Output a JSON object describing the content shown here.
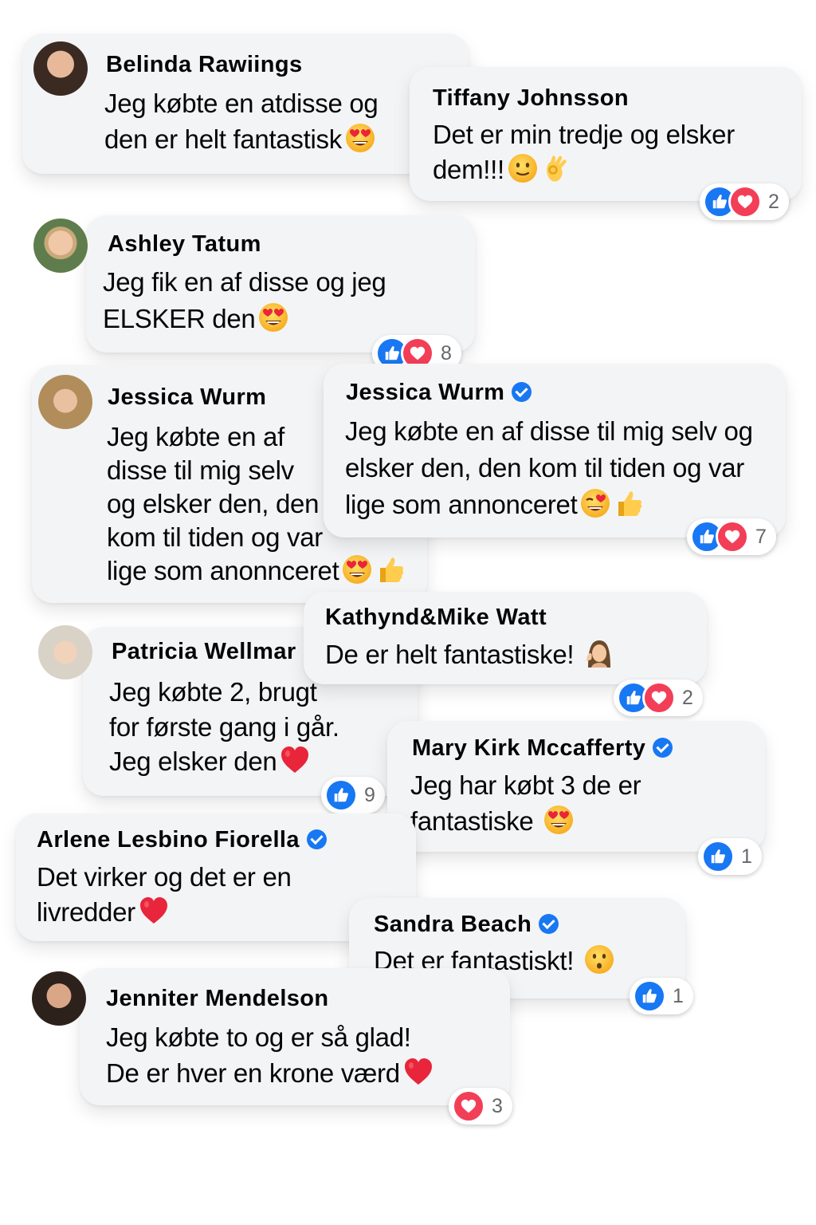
{
  "colors": {
    "bubble_bg": "#f3f4f6",
    "like_blue": "#1877f2",
    "love_red": "#f33e58",
    "verified_blue": "#1877f2",
    "count_gray": "#65676b"
  },
  "comments": [
    {
      "name": "Belinda Rawiings",
      "lines": [
        "Jeg købte en atdisse og",
        "den er helt fantastisk"
      ],
      "emojis": [
        "heart-eyes"
      ]
    },
    {
      "name": "Tiffany Johnsson",
      "lines": [
        "Det er min tredje og elsker",
        "dem!!!"
      ],
      "emojis": [
        "smiling-face",
        "ok-hand"
      ],
      "reactions": {
        "types": [
          "like",
          "love"
        ],
        "count": "2"
      }
    },
    {
      "name": "Ashley Tatum",
      "lines": [
        "Jeg fik en af disse og jeg",
        "ELSKER den"
      ],
      "emojis": [
        "heart-eyes"
      ],
      "reactions": {
        "types": [
          "like",
          "love"
        ],
        "count": "8"
      }
    },
    {
      "name": "Jessica Wurm",
      "lines": [
        "Jeg købte en af",
        "disse til mig selv",
        "og elsker den, den",
        "kom til tiden og var",
        "lige som anonnceret"
      ],
      "emojis": [
        "heart-eyes",
        "thumbs-up"
      ]
    },
    {
      "name": "Jessica Wurm",
      "verified": true,
      "lines": [
        "Jeg købte en af disse til mig selv og",
        "elsker den, den kom til tiden og var",
        "lige som annonceret"
      ],
      "emojis": [
        "winking-heart-eyes",
        "thumbs-up"
      ],
      "reactions": {
        "types": [
          "like",
          "love"
        ],
        "count": "7"
      }
    },
    {
      "name": "Kathynd&Mike Watt",
      "lines": [
        "De er helt fantastiske!"
      ],
      "emojis": [
        "woman-raising-hand"
      ],
      "reactions": {
        "types": [
          "like",
          "love"
        ],
        "count": "2"
      }
    },
    {
      "name": "Patricia Wellmar",
      "lines": [
        "Jeg købte 2, brugt",
        "for første gang i går.",
        "Jeg elsker den"
      ],
      "emojis": [
        "red-heart"
      ],
      "reactions": {
        "types": [
          "like"
        ],
        "count": "9"
      }
    },
    {
      "name": "Mary Kirk Mccafferty",
      "verified": true,
      "lines": [
        "Jeg har købt 3 de er",
        "fantastiske"
      ],
      "emojis": [
        "heart-eyes"
      ],
      "reactions": {
        "types": [
          "like"
        ],
        "count": "1"
      }
    },
    {
      "name": "Arlene Lesbino Fiorella",
      "verified": true,
      "lines": [
        "Det virker og det er en",
        "livredder"
      ],
      "emojis": [
        "red-heart"
      ]
    },
    {
      "name": "Sandra Beach",
      "verified": true,
      "lines": [
        "Det er fantastiskt!"
      ],
      "emojis": [
        "hushed-face"
      ],
      "reactions": {
        "types": [
          "like"
        ],
        "count": "1"
      }
    },
    {
      "name": "Jenniter Mendelson",
      "lines": [
        "Jeg købte to og er så glad!",
        "De er hver en krone værd"
      ],
      "emojis": [
        "red-heart"
      ],
      "reactions": {
        "types": [
          "love"
        ],
        "count": "3"
      }
    }
  ]
}
